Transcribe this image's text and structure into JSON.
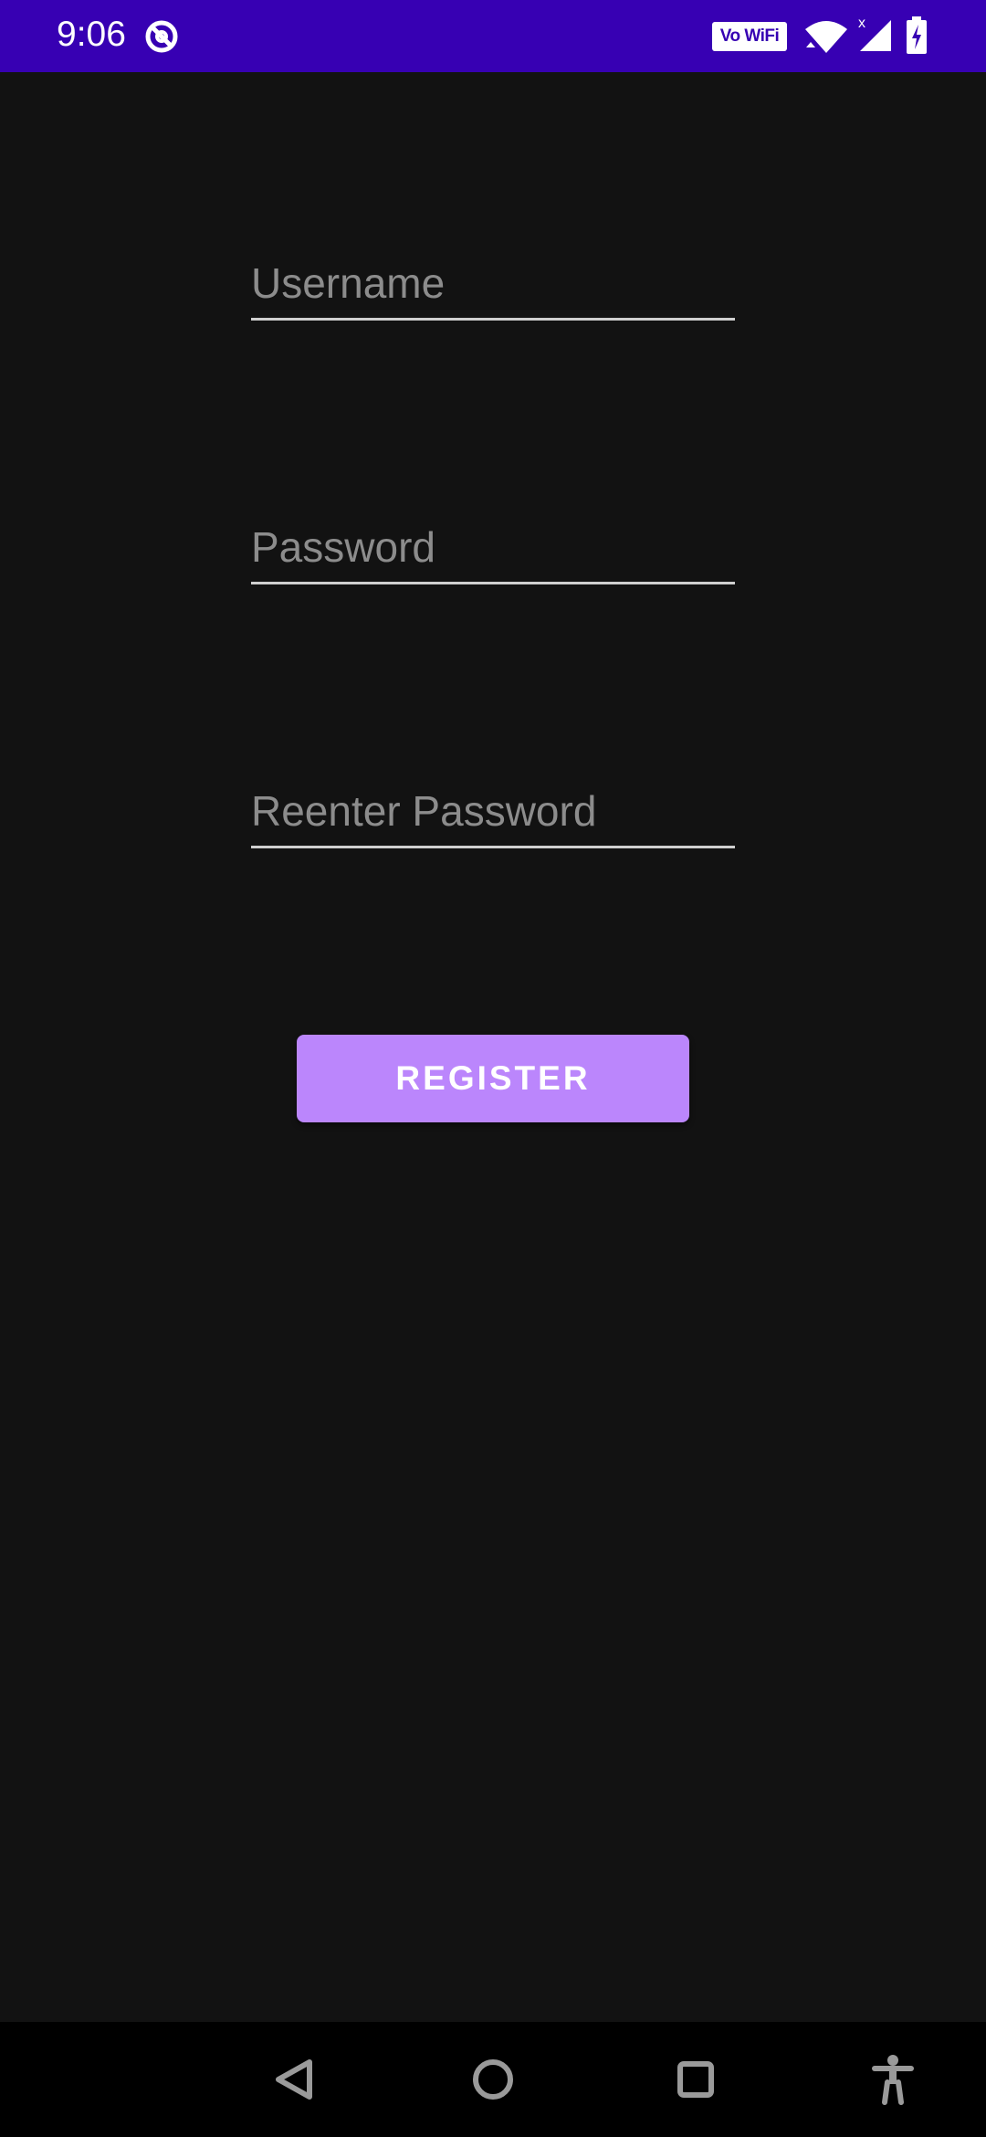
{
  "status_bar": {
    "time": "9:06",
    "vowifi_label": "Vo WiFi",
    "icons": [
      "at-sign-icon",
      "vowifi-icon",
      "wifi-icon",
      "signal-icon",
      "battery-charging-icon"
    ],
    "background_color": "#3700b3"
  },
  "form": {
    "username": {
      "value": "",
      "placeholder": "Username"
    },
    "password": {
      "value": "",
      "placeholder": "Password"
    },
    "reenter_password": {
      "value": "",
      "placeholder": "Reenter Password"
    },
    "register_label": "REGISTER",
    "accent_color": "#bb86fc"
  },
  "nav_bar": {
    "icons": [
      "back-icon",
      "home-icon",
      "recents-icon",
      "accessibility-icon"
    ]
  }
}
